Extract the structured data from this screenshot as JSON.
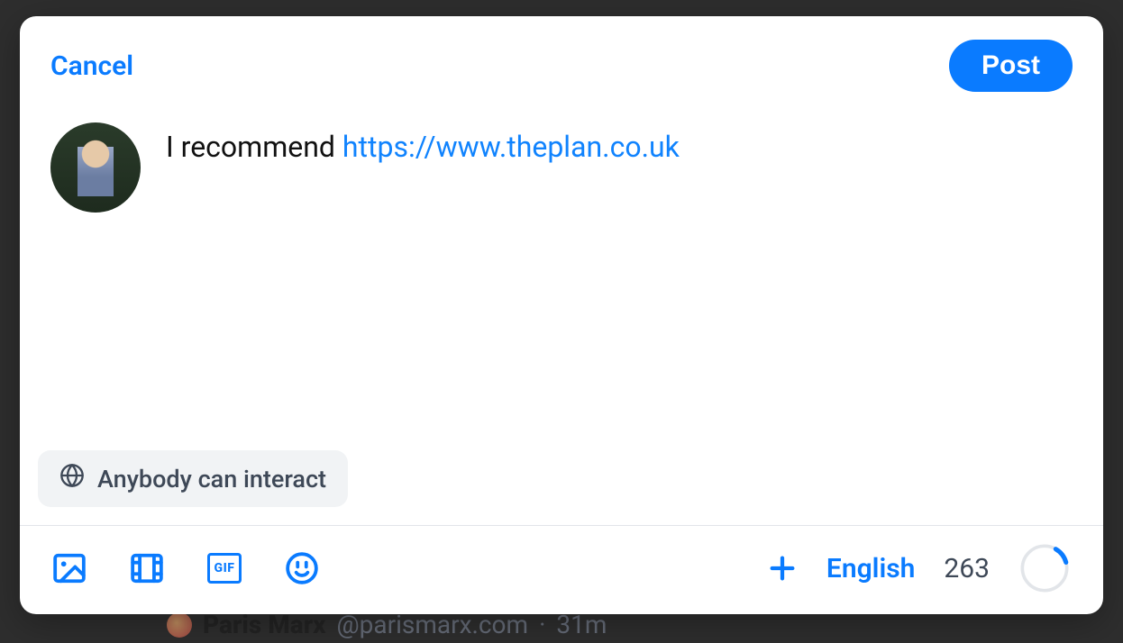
{
  "header": {
    "cancel_label": "Cancel",
    "post_label": "Post"
  },
  "compose": {
    "text_prefix": "I recommend ",
    "link_text": "https://www.theplan.co.uk"
  },
  "audience": {
    "label": "Anybody can interact",
    "icon": "globe-icon"
  },
  "toolbar": {
    "icons": {
      "image": "image-icon",
      "video": "video-icon",
      "gif_label": "GIF",
      "emoji": "emoji-icon",
      "add_thread": "plus-icon"
    },
    "language": "English",
    "chars_remaining": "263",
    "char_limit": 300,
    "chars_used": 37
  },
  "colors": {
    "accent": "#0a7bff",
    "text": "#111",
    "muted": "#3e4857",
    "chip_bg": "#f1f3f5"
  },
  "background_feed": {
    "display_name": "Paris Marx",
    "handle": "@parismarx.com",
    "time_sep": "·",
    "time": "31m"
  }
}
